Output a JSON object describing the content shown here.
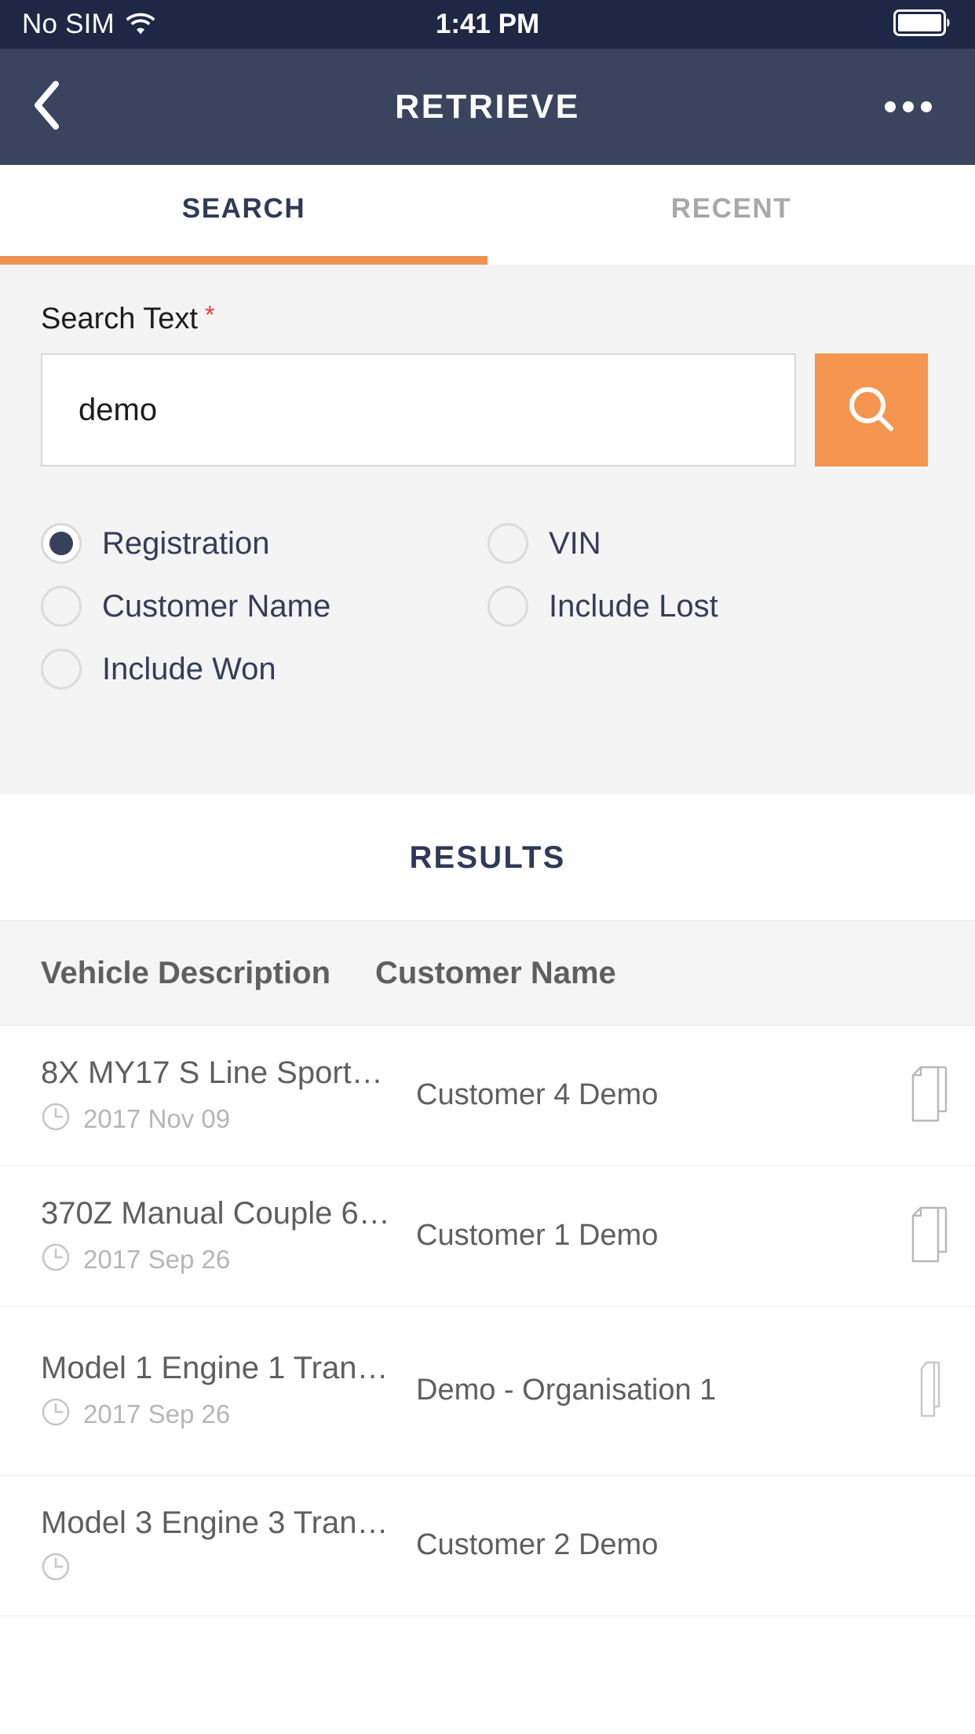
{
  "statusbar": {
    "carrier": "No SIM",
    "time": "1:41 PM",
    "wifi_icon": "wifi-icon",
    "battery_icon": "battery-full-icon"
  },
  "navbar": {
    "title": "RETRIEVE",
    "back_icon": "chevron-left-icon",
    "more_icon": "overflow-menu-icon"
  },
  "tabs": [
    {
      "label": "SEARCH",
      "active": true
    },
    {
      "label": "RECENT",
      "active": false
    }
  ],
  "search": {
    "label": "Search Text",
    "required_marker": "*",
    "value": "demo",
    "placeholder": "",
    "button_icon": "search-icon"
  },
  "options": [
    {
      "label": "Registration",
      "selected": true
    },
    {
      "label": "VIN",
      "selected": false
    },
    {
      "label": "Customer Name",
      "selected": false
    },
    {
      "label": "Include Lost",
      "selected": false
    },
    {
      "label": "Include Won",
      "selected": false
    }
  ],
  "results": {
    "heading": "RESULTS",
    "columns": [
      "Vehicle Description",
      "Customer Name"
    ],
    "rows": [
      {
        "description": "8X MY17 S Line Sport…",
        "date": "2017 Nov 09",
        "customer": "Customer 4 Demo",
        "clock_icon": "clock-icon",
        "action_icon": "copy-icon"
      },
      {
        "description": "370Z Manual Couple 6…",
        "date": "2017 Sep 26",
        "customer": "Customer 1 Demo",
        "clock_icon": "clock-icon",
        "action_icon": "copy-icon"
      },
      {
        "description": "Model 1 Engine 1 Tran…",
        "date": "2017 Sep 26",
        "customer": "Demo - Organisation 1",
        "clock_icon": "clock-icon",
        "action_icon": "copy-icon"
      },
      {
        "description": "Model 3 Engine 3 Tran…",
        "date": "",
        "customer": "Customer 2 Demo",
        "clock_icon": "clock-icon",
        "action_icon": ""
      }
    ]
  },
  "colors": {
    "statusbar_bg": "#1e2746",
    "navbar_bg": "#3b445f",
    "accent_orange": "#f5954f",
    "tab_active": "#2e3a58",
    "tab_inactive": "#a8a8a8",
    "panel_bg": "#f4f4f4",
    "required_red": "#e8413a",
    "text_gray": "#5f5f5f"
  }
}
